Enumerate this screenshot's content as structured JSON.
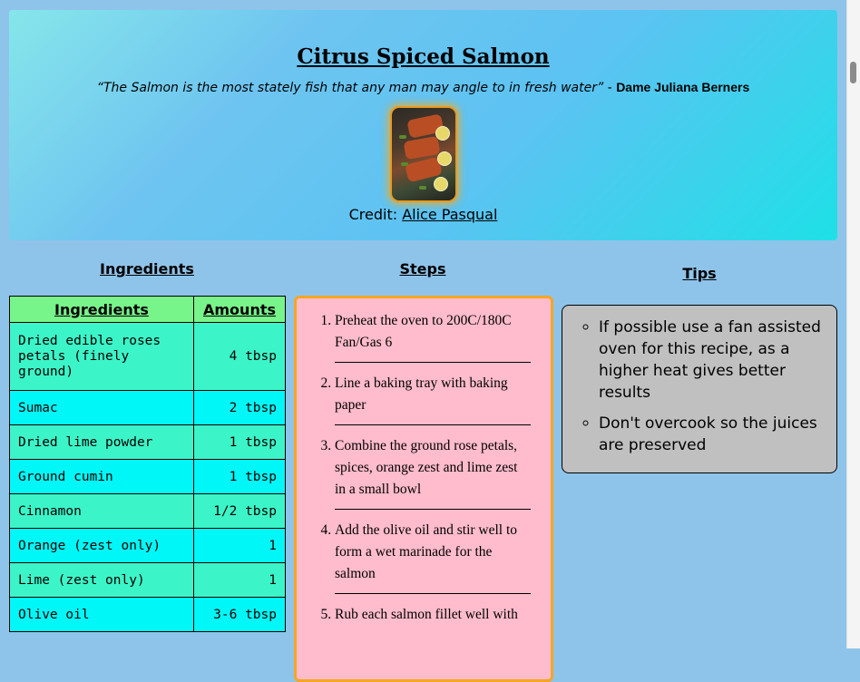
{
  "recipe": {
    "title": "Citrus Spiced Salmon",
    "quote_text": "“The Salmon is the most stately fish that any man may angle to in fresh water”",
    "quote_separator": " - ",
    "quote_author": "Dame Juliana Berners",
    "credit_label": "Credit: ",
    "credit_name": "Alice Pasqual"
  },
  "sections": {
    "ingredients": "Ingredients",
    "steps": "Steps",
    "tips": "Tips"
  },
  "ingredients_table": {
    "headers": [
      "Ingredients",
      "Amounts"
    ],
    "rows": [
      {
        "name": "Dried edible roses petals (finely ground)",
        "amount": "4 tbsp"
      },
      {
        "name": "Sumac",
        "amount": "2 tbsp"
      },
      {
        "name": "Dried lime powder",
        "amount": "1 tbsp"
      },
      {
        "name": "Ground cumin",
        "amount": "1 tbsp"
      },
      {
        "name": "Cinnamon",
        "amount": "1/2 tbsp"
      },
      {
        "name": "Orange (zest only)",
        "amount": "1"
      },
      {
        "name": "Lime (zest only)",
        "amount": "1"
      },
      {
        "name": "Olive oil",
        "amount": "3-6 tbsp"
      }
    ]
  },
  "steps": [
    "Preheat the oven to 200C/180C Fan/Gas 6",
    "Line a baking tray with baking paper",
    "Combine the ground rose petals, spices, orange zest and lime zest in a small bowl",
    "Add the olive oil and stir well to form a wet marinade for the salmon",
    "Rub each salmon fillet well with"
  ],
  "tips": [
    "If possible use a fan assisted oven for this recipe, as a higher heat gives better results",
    "Don't overcook so the juices are preserved"
  ],
  "colors": {
    "page_bg": "#8fc4ea",
    "table_header": "#78f58a",
    "row_a": "#3bf5c8",
    "row_b": "#00f7f7",
    "steps_bg": "#ffbccc",
    "steps_border": "#f5a623",
    "tips_bg": "#c0c0c0"
  }
}
